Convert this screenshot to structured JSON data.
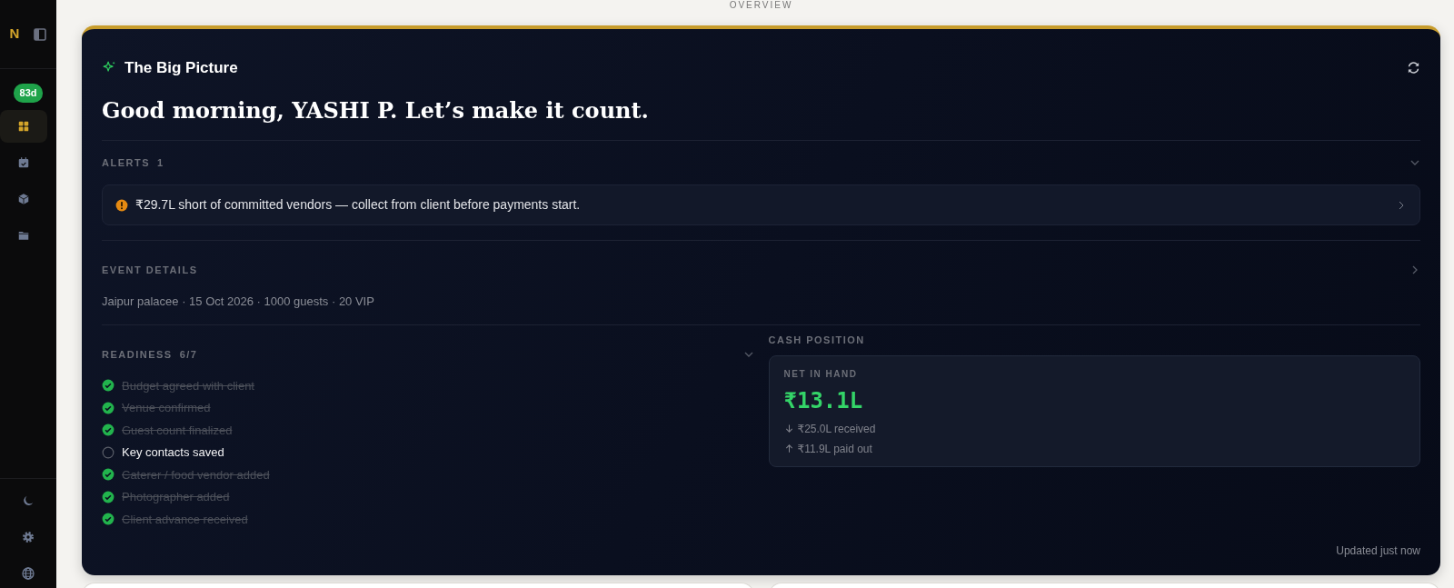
{
  "header": {
    "label": "OVERVIEW"
  },
  "sidebar": {
    "logo": "N",
    "countdown": "83d",
    "nav": [
      {
        "kind": "grid",
        "selected": true
      },
      {
        "kind": "calendar",
        "selected": false
      },
      {
        "kind": "package",
        "selected": false
      },
      {
        "kind": "folder",
        "selected": false
      }
    ],
    "footer": [
      {
        "kind": "moon"
      },
      {
        "kind": "gear"
      },
      {
        "kind": "globe"
      }
    ]
  },
  "card": {
    "title": "The Big Picture",
    "greeting": "Good morning, YASHI P. Let’s make it count.",
    "alerts": {
      "label": "ALERTS",
      "count": "1",
      "expanded": true,
      "items": [
        {
          "text": "₹29.7L short of committed vendors — collect from client before payments start."
        }
      ]
    },
    "event_details": {
      "label": "EVENT DETAILS",
      "expanded": false,
      "summary": "Jaipur palacee · 15 Oct 2026 · 1000 guests · 20 VIP"
    },
    "readiness": {
      "label": "READINESS",
      "count": "6/7",
      "expanded": true,
      "items": [
        {
          "text": "Budget agreed with client",
          "checked": true
        },
        {
          "text": "Venue confirmed",
          "checked": true
        },
        {
          "text": "Guest count finalized",
          "checked": true
        },
        {
          "text": "Key contacts saved",
          "checked": false
        },
        {
          "text": "Caterer / food vendor added",
          "checked": true
        },
        {
          "text": "Photographer added",
          "checked": true
        },
        {
          "text": "Client advance received",
          "checked": true
        }
      ]
    },
    "cash_position": {
      "label": "CASH POSITION",
      "net_label": "NET IN HAND",
      "net_value": "₹13.1L",
      "received": "₹25.0L received",
      "paid_out": "₹11.9L paid out"
    },
    "updated": "Updated just now"
  }
}
